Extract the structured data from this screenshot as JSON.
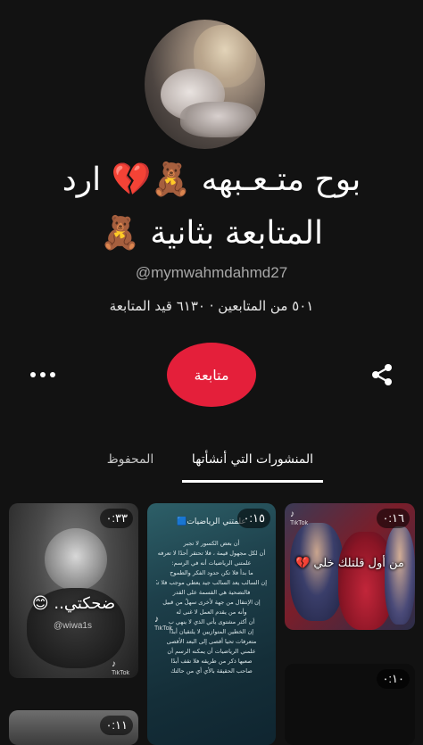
{
  "profile": {
    "name_line1": "ﺑﻮﺡ ﻣﺘـﻌـﺒﻬﻪ 🧸💔 ارد",
    "name_line2": "المتابعة بثانية 🧸",
    "handle": "@mymwahmdahmd27",
    "stats": "٥٠١ من المتابعين · ٦١٣٠ قيد المتابعة"
  },
  "actions": {
    "follow_label": "متابعة",
    "more_icon": "more-horizontal-icon",
    "share_icon": "share-icon"
  },
  "tabs": {
    "created": "المنشورات التي أنشأتها",
    "saved": "المحفوظ",
    "active": "created"
  },
  "grid": {
    "items": [
      {
        "duration": "٠:٣٣",
        "caption": "ضحكتي.. 😊",
        "handle": "@wiwa1s",
        "watermark": "TikTok"
      },
      {
        "duration": "٠:١٥",
        "title": "علمتني الرياضيات🟦",
        "lines": [
          "أن بعض الكسور لا تجبر",
          "أن لكل مجهول قيمة ، فلا تحتقر أحدًا لا تعرفه",
          "علمتني الرياضيات أنه في الرسم:",
          "ما بدأ فلا تكن حدود الفكر والطموح",
          "إن السالب يعد السالب جيد يعطي موجب فلا تكن",
          "فالتضحية هي القسمة على القدر",
          "إن الإنتقال من جهة لأخرى سهلٌ من قبيل",
          "وأنه من يقدم العمل لا غنى له",
          "أن أكثر مشتوى يأتي الذي لا ينهي ب",
          "إن الخطين المتوازيين لا يلتقيان أبدًا",
          "متعرفات تحيا أقصى إلى البعد الأقصى",
          "علمني الرياضيات أن يمكنه الرسم أن",
          "صعبها ذكر من طريقه فلا تقف أبدًا",
          "صاحب الحقيقة بالأي أي من حالتك"
        ],
        "watermark": "TikTok"
      },
      {
        "duration": "٠:١٦",
        "caption": "من أول قلتلك خلي 💔",
        "watermark": "TikTok"
      },
      {
        "duration": "٠:١٠"
      },
      {
        "duration": "٠:١١"
      }
    ]
  },
  "colors": {
    "background": "#121212",
    "accent": "#e41f3a",
    "muted_text": "#a8a8a8"
  }
}
